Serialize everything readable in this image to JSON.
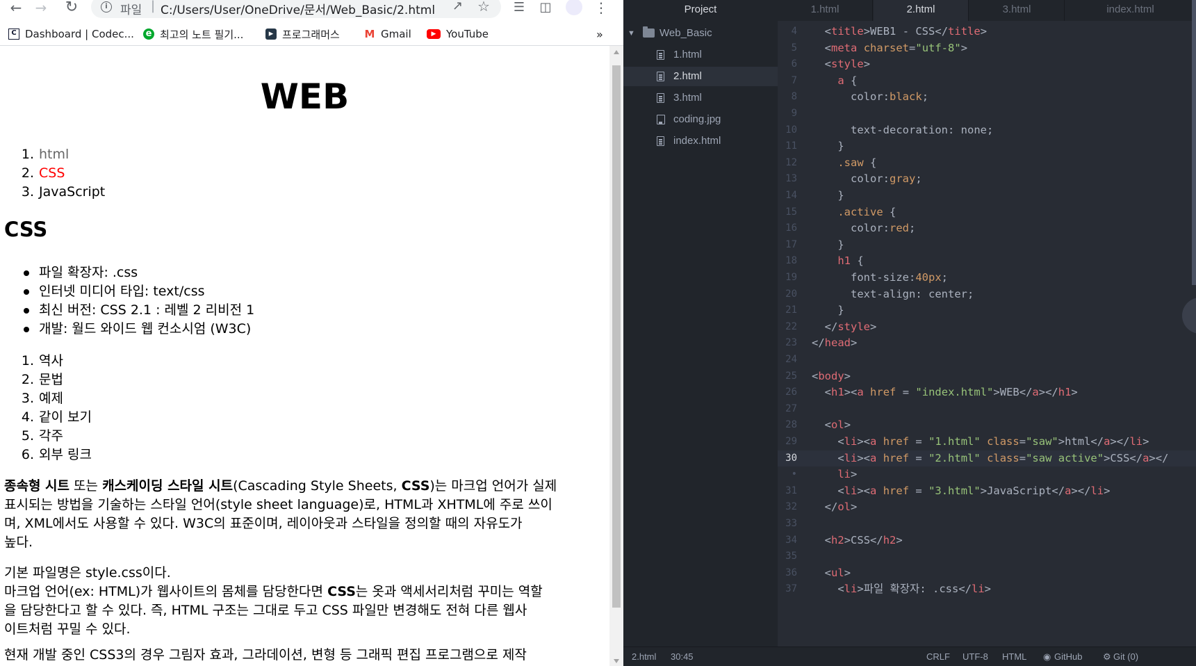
{
  "browser": {
    "scheme": "파일",
    "url": "C:/Users/User/OneDrive/문서/Web_Basic/2.html",
    "bookmarks": [
      "Dashboard | Codec...",
      "최고의 노트 필기...",
      "프로그래머스",
      "Gmail",
      "YouTube"
    ],
    "bookmark_more": "»"
  },
  "page": {
    "h1": "WEB",
    "nav": [
      "html",
      "CSS",
      "JavaScript"
    ],
    "h2": "CSS",
    "facts": [
      "파일 확장자: .css",
      "인터넷 미디어 타입: text/css",
      "최신 버전: CSS 2.1 : 레벨 2 리비전 1",
      "개발: 월드 와이드 웹 컨소시엄 (W3C)"
    ],
    "toc": [
      "역사",
      "문법",
      "예제",
      "같이 보기",
      "각주",
      "외부 링크"
    ],
    "para1": {
      "b1": "종속형 시트",
      "t1": " 또는 ",
      "b2": "캐스케이딩 스타일 시트",
      "t2": "(Cascading Style Sheets, ",
      "b3": "CSS",
      "t3": ")는 마크업 언어가 실제",
      "line2": "표시되는 방법을 기술하는 스타일 언어(style sheet language)로, HTML과 XHTML에 주로 쓰이",
      "line3": "며, XML에서도 사용할 수 있다. W3C의 표준이며, 레이아웃과 스타일을 정의할 때의 자유도가",
      "line4": "높다."
    },
    "para2": {
      "line1": "기본 파일명은 style.css이다.",
      "l2a": "마크업 언어(ex: HTML)가 웹사이트의 몸체를 담당한다면 ",
      "l2b": "CSS",
      "l2c": "는 옷과 액세서리처럼 꾸미는 역할",
      "line3": "을 담당한다고 할 수 있다. 즉, HTML 구조는 그대로 두고 CSS 파일만 변경해도 전혀 다른 웹사",
      "line4": "이트처럼 꾸밀 수 있다."
    },
    "para3_partial": "현재 개발 중인 CSS3의 경우 그림자 효과, 그라데이션, 변형 등 그래픽 편집 프로그램으로 제작"
  },
  "editor": {
    "tree_header": "Project",
    "folder": "Web_Basic",
    "files": [
      "1.html",
      "2.html",
      "3.html",
      "coding.jpg",
      "index.html"
    ],
    "selected_file": "2.html",
    "tabs": [
      "1.html",
      "2.html",
      "3.html",
      "index.html"
    ],
    "active_tab": "2.html",
    "status": {
      "file": "2.html",
      "cursor": "30:45",
      "eol": "CRLF",
      "encoding": "UTF-8",
      "grammar": "HTML",
      "github": "GitHub",
      "git": "Git (0)"
    }
  },
  "code_lines": [
    {
      "n": "4",
      "html": "  <span class='p'>&lt;</span><span class='t'>title</span><span class='p'>&gt;</span><span class='v'>WEB1 - CSS</span><span class='p'>&lt;/</span><span class='t'>title</span><span class='p'>&gt;</span>"
    },
    {
      "n": "5",
      "html": "  <span class='p'>&lt;</span><span class='t'>meta</span> <span class='a'>charset</span><span class='p'>=</span><span class='s'>\"utf-8\"</span><span class='p'>&gt;</span>"
    },
    {
      "n": "6",
      "html": "  <span class='p'>&lt;</span><span class='t'>style</span><span class='p'>&gt;</span>"
    },
    {
      "n": "7",
      "html": "    <span class='t'>a</span> <span class='p'>{</span>"
    },
    {
      "n": "8",
      "html": "      <span class='v'>color</span><span class='p'>:</span><span class='c'>black</span><span class='p'>;</span>"
    },
    {
      "n": "9",
      "html": ""
    },
    {
      "n": "10",
      "html": "      <span class='v'>text-decoration</span><span class='p'>: </span><span class='v'>none</span><span class='p'>;</span>"
    },
    {
      "n": "11",
      "html": "    <span class='p'>}</span>"
    },
    {
      "n": "12",
      "html": "    <span class='c'>.saw</span> <span class='p'>{</span>"
    },
    {
      "n": "13",
      "html": "      <span class='v'>color</span><span class='p'>:</span><span class='c'>gray</span><span class='p'>;</span>"
    },
    {
      "n": "14",
      "html": "    <span class='p'>}</span>"
    },
    {
      "n": "15",
      "html": "    <span class='c'>.active</span> <span class='p'>{</span>"
    },
    {
      "n": "16",
      "html": "      <span class='v'>color</span><span class='p'>:</span><span class='c'>red</span><span class='p'>;</span>"
    },
    {
      "n": "17",
      "html": "    <span class='p'>}</span>"
    },
    {
      "n": "18",
      "html": "    <span class='t'>h1</span> <span class='p'>{</span>"
    },
    {
      "n": "19",
      "html": "      <span class='v'>font-size</span><span class='p'>:</span><span class='n'>40px</span><span class='p'>;</span>"
    },
    {
      "n": "20",
      "html": "      <span class='v'>text-align</span><span class='p'>: </span><span class='v'>center</span><span class='p'>;</span>"
    },
    {
      "n": "21",
      "html": "    <span class='p'>}</span>"
    },
    {
      "n": "22",
      "html": "  <span class='p'>&lt;/</span><span class='t'>style</span><span class='p'>&gt;</span>"
    },
    {
      "n": "23",
      "html": "<span class='p'>&lt;/</span><span class='t'>head</span><span class='p'>&gt;</span>"
    },
    {
      "n": "24",
      "html": ""
    },
    {
      "n": "25",
      "html": "<span class='p'>&lt;</span><span class='t'>body</span><span class='p'>&gt;</span>"
    },
    {
      "n": "26",
      "html": "  <span class='p'>&lt;</span><span class='t'>h1</span><span class='p'>&gt;&lt;</span><span class='t'>a</span> <span class='a'>href</span> <span class='p'>=</span> <span class='s'>\"index.html\"</span><span class='p'>&gt;</span><span class='v'>WEB</span><span class='p'>&lt;/</span><span class='t'>a</span><span class='p'>&gt;&lt;/</span><span class='t'>h1</span><span class='p'>&gt;</span>"
    },
    {
      "n": "27",
      "html": ""
    },
    {
      "n": "28",
      "html": "  <span class='p'>&lt;</span><span class='t'>ol</span><span class='p'>&gt;</span>"
    },
    {
      "n": "29",
      "html": "    <span class='p'>&lt;</span><span class='t'>li</span><span class='p'>&gt;&lt;</span><span class='t'>a</span> <span class='a'>href</span> <span class='p'>=</span> <span class='s'>\"1.html\"</span> <span class='a'>class</span><span class='p'>=</span><span class='s'>\"saw\"</span><span class='p'>&gt;</span><span class='v'>html</span><span class='p'>&lt;/</span><span class='t'>a</span><span class='p'>&gt;&lt;/</span><span class='t'>li</span><span class='p'>&gt;</span>"
    },
    {
      "n": "30",
      "html": "    <span class='p'>&lt;</span><span class='t'>li</span><span class='p'>&gt;&lt;</span><span class='t'>a</span> <span class='a'>href</span> <span class='p'>=</span> <span class='s'>\"2.html\"</span> <span class='a'>class</span><span class='p'>=</span><span class='s'>\"saw active\"</span><span class='p'>&gt;</span><span class='v'>CSS</span><span class='p'>&lt;/</span><span class='t'>a</span><span class='p'>&gt;&lt;/</span>",
      "cur": true
    },
    {
      "n": "•",
      "html": "    <span class='t'>li</span><span class='p'>&gt;</span>"
    },
    {
      "n": "31",
      "html": "    <span class='p'>&lt;</span><span class='t'>li</span><span class='p'>&gt;&lt;</span><span class='t'>a</span> <span class='a'>href</span> <span class='p'>=</span> <span class='s'>\"3.html\"</span><span class='p'>&gt;</span><span class='v'>JavaScript</span><span class='p'>&lt;/</span><span class='t'>a</span><span class='p'>&gt;&lt;/</span><span class='t'>li</span><span class='p'>&gt;</span>"
    },
    {
      "n": "32",
      "html": "  <span class='p'>&lt;/</span><span class='t'>ol</span><span class='p'>&gt;</span>"
    },
    {
      "n": "33",
      "html": ""
    },
    {
      "n": "34",
      "html": "  <span class='p'>&lt;</span><span class='t'>h2</span><span class='p'>&gt;</span><span class='v'>CSS</span><span class='p'>&lt;/</span><span class='t'>h2</span><span class='p'>&gt;</span>"
    },
    {
      "n": "35",
      "html": ""
    },
    {
      "n": "36",
      "html": "  <span class='p'>&lt;</span><span class='t'>ul</span><span class='p'>&gt;</span>"
    },
    {
      "n": "37",
      "html": "    <span class='p'>&lt;</span><span class='t'>li</span><span class='p'>&gt;</span><span class='v'>파일 확장자: .css</span><span class='p'>&lt;/</span><span class='t'>li</span><span class='p'>&gt;</span>"
    }
  ]
}
